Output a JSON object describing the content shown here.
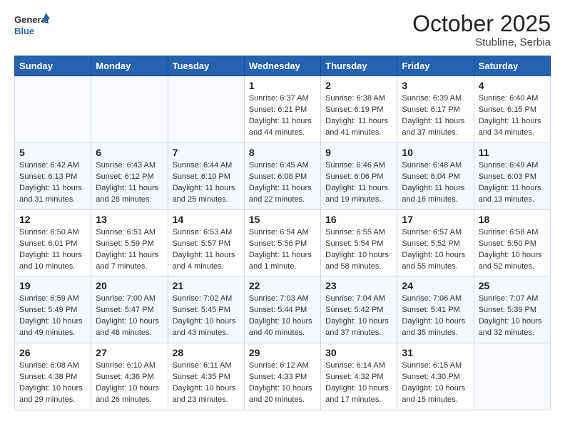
{
  "header": {
    "logo_general": "General",
    "logo_blue": "Blue",
    "month_title": "October 2025",
    "location": "Stubline, Serbia"
  },
  "weekdays": [
    "Sunday",
    "Monday",
    "Tuesday",
    "Wednesday",
    "Thursday",
    "Friday",
    "Saturday"
  ],
  "weeks": [
    [
      {
        "day": "",
        "text": ""
      },
      {
        "day": "",
        "text": ""
      },
      {
        "day": "",
        "text": ""
      },
      {
        "day": "1",
        "text": "Sunrise: 6:37 AM\nSunset: 6:21 PM\nDaylight: 11 hours and 44 minutes."
      },
      {
        "day": "2",
        "text": "Sunrise: 6:38 AM\nSunset: 6:19 PM\nDaylight: 11 hours and 41 minutes."
      },
      {
        "day": "3",
        "text": "Sunrise: 6:39 AM\nSunset: 6:17 PM\nDaylight: 11 hours and 37 minutes."
      },
      {
        "day": "4",
        "text": "Sunrise: 6:40 AM\nSunset: 6:15 PM\nDaylight: 11 hours and 34 minutes."
      }
    ],
    [
      {
        "day": "5",
        "text": "Sunrise: 6:42 AM\nSunset: 6:13 PM\nDaylight: 11 hours and 31 minutes."
      },
      {
        "day": "6",
        "text": "Sunrise: 6:43 AM\nSunset: 6:12 PM\nDaylight: 11 hours and 28 minutes."
      },
      {
        "day": "7",
        "text": "Sunrise: 6:44 AM\nSunset: 6:10 PM\nDaylight: 11 hours and 25 minutes."
      },
      {
        "day": "8",
        "text": "Sunrise: 6:45 AM\nSunset: 6:08 PM\nDaylight: 11 hours and 22 minutes."
      },
      {
        "day": "9",
        "text": "Sunrise: 6:46 AM\nSunset: 6:06 PM\nDaylight: 11 hours and 19 minutes."
      },
      {
        "day": "10",
        "text": "Sunrise: 6:48 AM\nSunset: 6:04 PM\nDaylight: 11 hours and 16 minutes."
      },
      {
        "day": "11",
        "text": "Sunrise: 6:49 AM\nSunset: 6:03 PM\nDaylight: 11 hours and 13 minutes."
      }
    ],
    [
      {
        "day": "12",
        "text": "Sunrise: 6:50 AM\nSunset: 6:01 PM\nDaylight: 11 hours and 10 minutes."
      },
      {
        "day": "13",
        "text": "Sunrise: 6:51 AM\nSunset: 5:59 PM\nDaylight: 11 hours and 7 minutes."
      },
      {
        "day": "14",
        "text": "Sunrise: 6:53 AM\nSunset: 5:57 PM\nDaylight: 11 hours and 4 minutes."
      },
      {
        "day": "15",
        "text": "Sunrise: 6:54 AM\nSunset: 5:56 PM\nDaylight: 11 hours and 1 minute."
      },
      {
        "day": "16",
        "text": "Sunrise: 6:55 AM\nSunset: 5:54 PM\nDaylight: 10 hours and 58 minutes."
      },
      {
        "day": "17",
        "text": "Sunrise: 6:57 AM\nSunset: 5:52 PM\nDaylight: 10 hours and 55 minutes."
      },
      {
        "day": "18",
        "text": "Sunrise: 6:58 AM\nSunset: 5:50 PM\nDaylight: 10 hours and 52 minutes."
      }
    ],
    [
      {
        "day": "19",
        "text": "Sunrise: 6:59 AM\nSunset: 5:49 PM\nDaylight: 10 hours and 49 minutes."
      },
      {
        "day": "20",
        "text": "Sunrise: 7:00 AM\nSunset: 5:47 PM\nDaylight: 10 hours and 46 minutes."
      },
      {
        "day": "21",
        "text": "Sunrise: 7:02 AM\nSunset: 5:45 PM\nDaylight: 10 hours and 43 minutes."
      },
      {
        "day": "22",
        "text": "Sunrise: 7:03 AM\nSunset: 5:44 PM\nDaylight: 10 hours and 40 minutes."
      },
      {
        "day": "23",
        "text": "Sunrise: 7:04 AM\nSunset: 5:42 PM\nDaylight: 10 hours and 37 minutes."
      },
      {
        "day": "24",
        "text": "Sunrise: 7:06 AM\nSunset: 5:41 PM\nDaylight: 10 hours and 35 minutes."
      },
      {
        "day": "25",
        "text": "Sunrise: 7:07 AM\nSunset: 5:39 PM\nDaylight: 10 hours and 32 minutes."
      }
    ],
    [
      {
        "day": "26",
        "text": "Sunrise: 6:08 AM\nSunset: 4:38 PM\nDaylight: 10 hours and 29 minutes."
      },
      {
        "day": "27",
        "text": "Sunrise: 6:10 AM\nSunset: 4:36 PM\nDaylight: 10 hours and 26 minutes."
      },
      {
        "day": "28",
        "text": "Sunrise: 6:11 AM\nSunset: 4:35 PM\nDaylight: 10 hours and 23 minutes."
      },
      {
        "day": "29",
        "text": "Sunrise: 6:12 AM\nSunset: 4:33 PM\nDaylight: 10 hours and 20 minutes."
      },
      {
        "day": "30",
        "text": "Sunrise: 6:14 AM\nSunset: 4:32 PM\nDaylight: 10 hours and 17 minutes."
      },
      {
        "day": "31",
        "text": "Sunrise: 6:15 AM\nSunset: 4:30 PM\nDaylight: 10 hours and 15 minutes."
      },
      {
        "day": "",
        "text": ""
      }
    ]
  ]
}
